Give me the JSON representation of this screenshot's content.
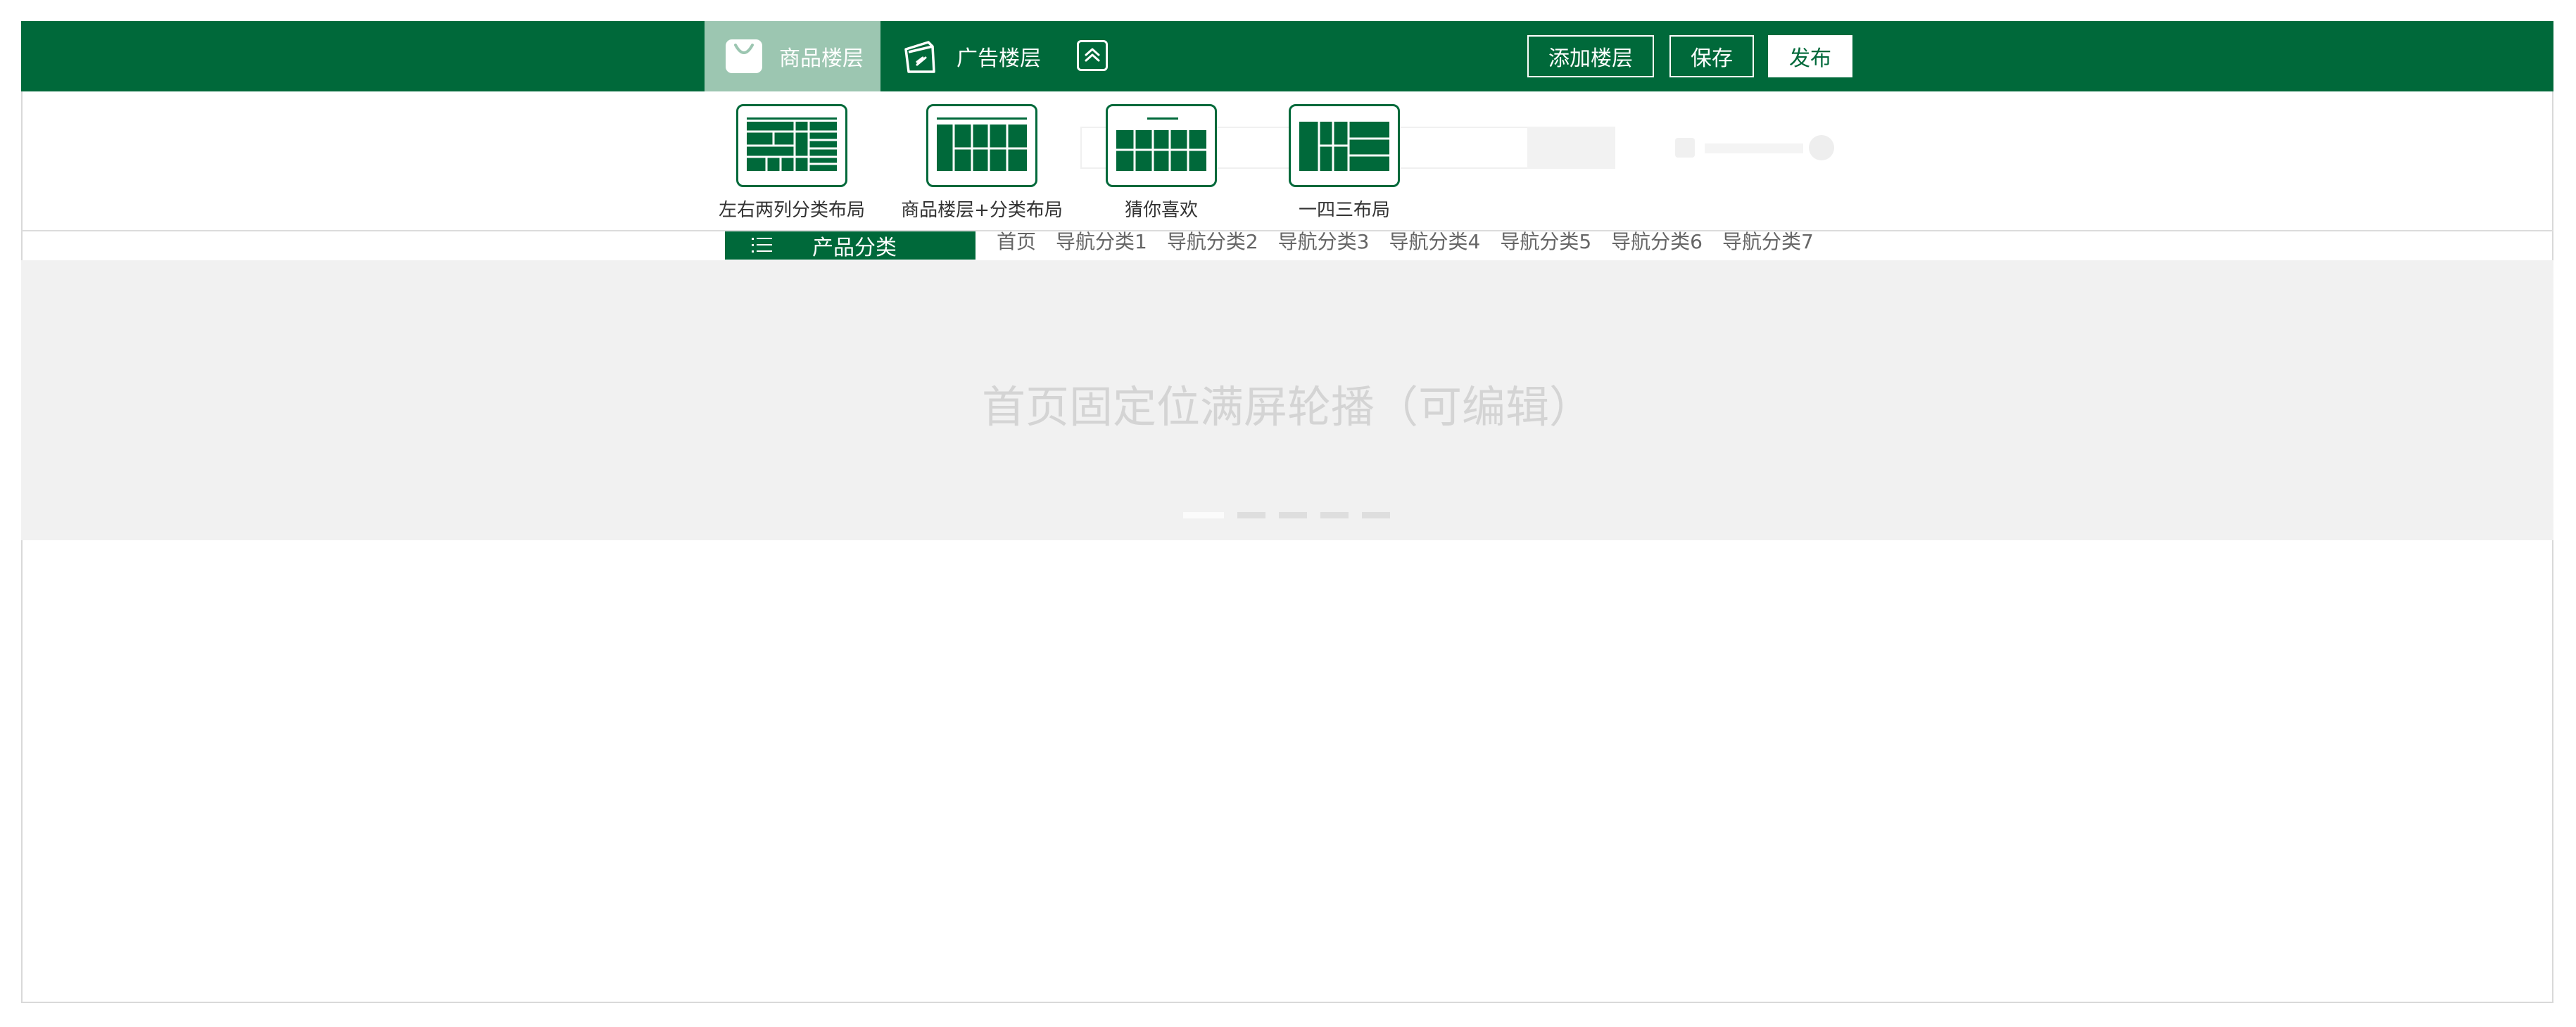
{
  "toolbar": {
    "tabs": [
      {
        "label": "商品楼层",
        "icon": "shopping-bag-icon",
        "active": true
      },
      {
        "label": "广告楼层",
        "icon": "ad-card-icon",
        "active": false
      }
    ],
    "collapse_icon": "chevron-up-icon",
    "buttons": {
      "add_floor": "添加楼层",
      "save": "保存",
      "publish": "发布"
    },
    "colors": {
      "brand": "#00693a",
      "active_tab": "#9cc6b1"
    }
  },
  "layouts": [
    {
      "label": "左右两列分类布局",
      "icon": "two-column-layout-icon"
    },
    {
      "label": "商品楼层+分类布局",
      "icon": "floor-category-layout-icon"
    },
    {
      "label": "猜你喜欢",
      "icon": "recommend-layout-icon"
    },
    {
      "label": "一四三布局",
      "icon": "one-four-three-layout-icon"
    }
  ],
  "nav": {
    "category_button": "产品分类",
    "items": [
      "首页",
      "导航分类1",
      "导航分类2",
      "导航分类3",
      "导航分类4",
      "导航分类5",
      "导航分类6",
      "导航分类7"
    ]
  },
  "banner": {
    "text": "首页固定位满屏轮播（可编辑）",
    "slide_count": 5,
    "active_slide": 1
  }
}
